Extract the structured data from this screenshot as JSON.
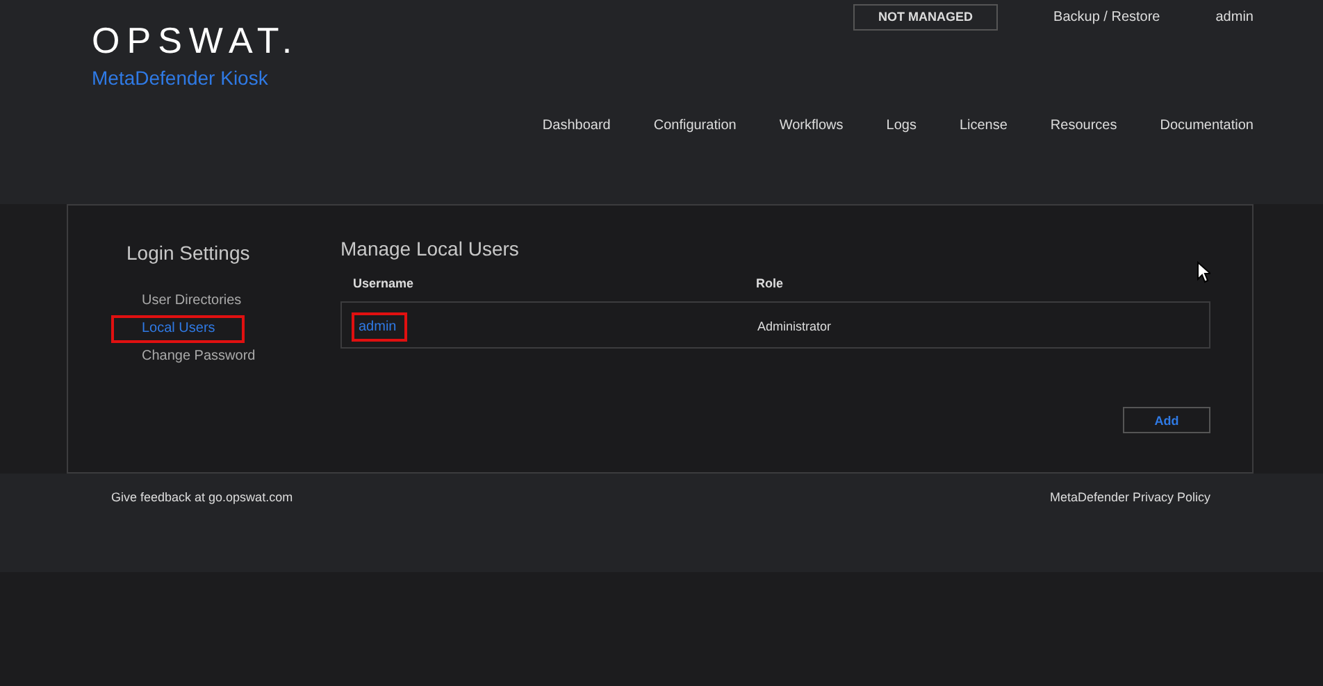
{
  "header": {
    "logo": "OPSWAT.",
    "product": "MetaDefender Kiosk",
    "status_badge": "NOT MANAGED",
    "top_links": [
      "Backup / Restore",
      "admin"
    ]
  },
  "nav": [
    {
      "label": "Dashboard",
      "selected": false
    },
    {
      "label": "Configuration",
      "selected": false
    },
    {
      "label": "Workflows",
      "selected": false
    },
    {
      "label": "Logs",
      "selected": false
    },
    {
      "label": "License",
      "selected": false
    },
    {
      "label": "Resources",
      "selected": false
    },
    {
      "label": "Documentation",
      "selected": false
    }
  ],
  "sidebar": {
    "title": "Login Settings",
    "items": [
      {
        "label": "User Directories",
        "selected": false,
        "highlighted": false
      },
      {
        "label": "Local Users",
        "selected": true,
        "highlighted": true
      },
      {
        "label": "Change Password",
        "selected": false,
        "highlighted": false
      }
    ]
  },
  "main": {
    "title": "Manage Local Users",
    "table": {
      "columns": [
        "Username",
        "Role"
      ],
      "rows": [
        {
          "username": "admin",
          "role": "Administrator",
          "highlighted": true
        }
      ]
    },
    "add_button": "Add"
  },
  "footer": {
    "feedback": "Give feedback at go.opswat.com",
    "privacy": "MetaDefender Privacy Policy"
  }
}
